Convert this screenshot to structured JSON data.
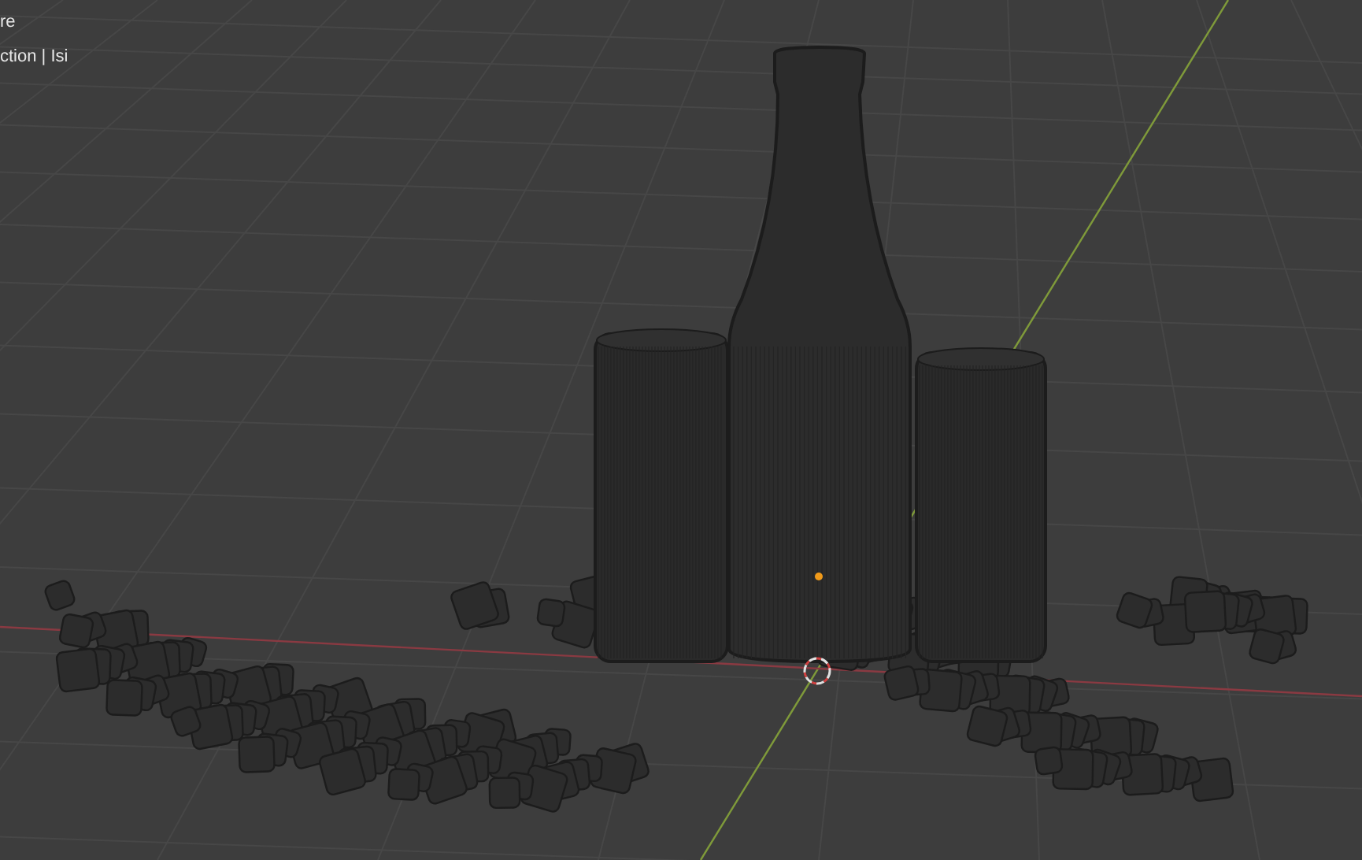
{
  "viewport": {
    "overlay_lines": [
      "re",
      "ction | Isi"
    ]
  }
}
